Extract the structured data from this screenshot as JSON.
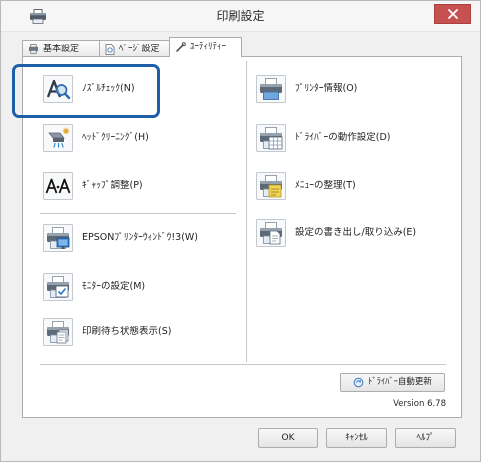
{
  "window": {
    "title": "印刷設定",
    "app_icon": "printer-icon",
    "close_icon": "close-icon"
  },
  "tabs": [
    {
      "label": "基本設定",
      "icon": "basic-settings-icon",
      "active": false
    },
    {
      "label": "ﾍﾟｰｼﾞ設定",
      "icon": "page-setup-icon",
      "active": false
    },
    {
      "label": "ﾕｰﾃｨﾘﾃｨｰ",
      "icon": "utility-icon",
      "active": true
    }
  ],
  "utility": {
    "left": [
      {
        "label": "ﾉｽﾞﾙﾁｪｯｸ(N)",
        "icon": "nozzle-check-icon"
      },
      {
        "label": "ﾍｯﾄﾞｸﾘｰﾆﾝｸﾞ(H)",
        "icon": "head-cleaning-icon"
      },
      {
        "label": "ｷﾞｬｯﾌﾟ調整(P)",
        "icon": "gap-adjustment-icon"
      },
      {
        "label": "EPSONﾌﾟﾘﾝﾀｰｳｨﾝﾄﾞｳ!3(W)",
        "icon": "status-monitor-icon"
      },
      {
        "label": "ﾓﾆﾀｰの設定(M)",
        "icon": "monitor-settings-icon"
      },
      {
        "label": "印刷待ち状態表示(S)",
        "icon": "print-queue-icon"
      }
    ],
    "right": [
      {
        "label": "ﾌﾟﾘﾝﾀｰ情報(O)",
        "icon": "printer-info-icon"
      },
      {
        "label": "ﾄﾞﾗｲﾊﾞｰの動作設定(D)",
        "icon": "driver-settings-icon"
      },
      {
        "label": "ﾒﾆｭｰの整理(T)",
        "icon": "menu-arrange-icon"
      },
      {
        "label": "設定の書き出し/取り込み(E)",
        "icon": "export-import-icon"
      }
    ],
    "driver_update": {
      "label": "ﾄﾞﾗｲﾊﾞｰ自動更新",
      "icon": "update-icon"
    },
    "version": "Version 6.78"
  },
  "buttons": {
    "ok": "OK",
    "cancel": "ｷｬﾝｾﾙ",
    "help": "ﾍﾙﾌﾟ"
  },
  "colors": {
    "close_button": "#c75050",
    "highlight_border": "#1f5ea8",
    "panel_border": "#adadad",
    "window_bg": "#f0f0f0",
    "title_bg": "#f6f6f6"
  }
}
